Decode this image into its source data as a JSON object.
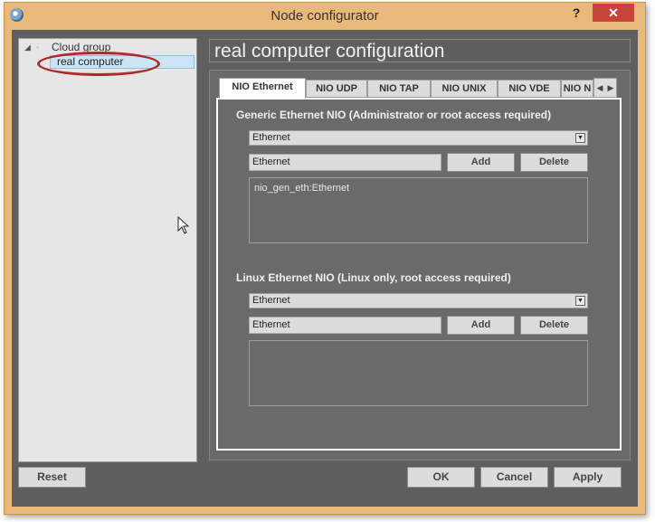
{
  "window": {
    "title": "Node configurator",
    "help_label": "?",
    "close_label": "✕"
  },
  "tree": {
    "parent_label": "Cloud group",
    "selected_label": "real computer"
  },
  "main": {
    "title": "real computer configuration"
  },
  "tabs": [
    {
      "label": "NIO Ethernet",
      "active": true
    },
    {
      "label": "NIO UDP"
    },
    {
      "label": "NIO TAP"
    },
    {
      "label": "NIO UNIX"
    },
    {
      "label": "NIO VDE"
    },
    {
      "label": "NIO N"
    }
  ],
  "tab_scroll": {
    "left": "◀",
    "right": "▶"
  },
  "generic": {
    "label": "Generic Ethernet NIO (Administrator or root access required)",
    "combo_value": "Ethernet",
    "input_value": "Ethernet",
    "add_label": "Add",
    "delete_label": "Delete",
    "list_items": [
      "nio_gen_eth:Ethernet"
    ]
  },
  "linux": {
    "label": "Linux Ethernet NIO (Linux only, root access required)",
    "combo_value": "Ethernet",
    "input_value": "Ethernet",
    "add_label": "Add",
    "delete_label": "Delete",
    "list_items": []
  },
  "buttons": {
    "reset": "Reset",
    "ok": "OK",
    "cancel": "Cancel",
    "apply": "Apply"
  },
  "colors": {
    "frame": "#e9b97c",
    "client_bg": "#5f5f5f",
    "annotation": "#b02a2a",
    "selection": "#cce4f6"
  }
}
